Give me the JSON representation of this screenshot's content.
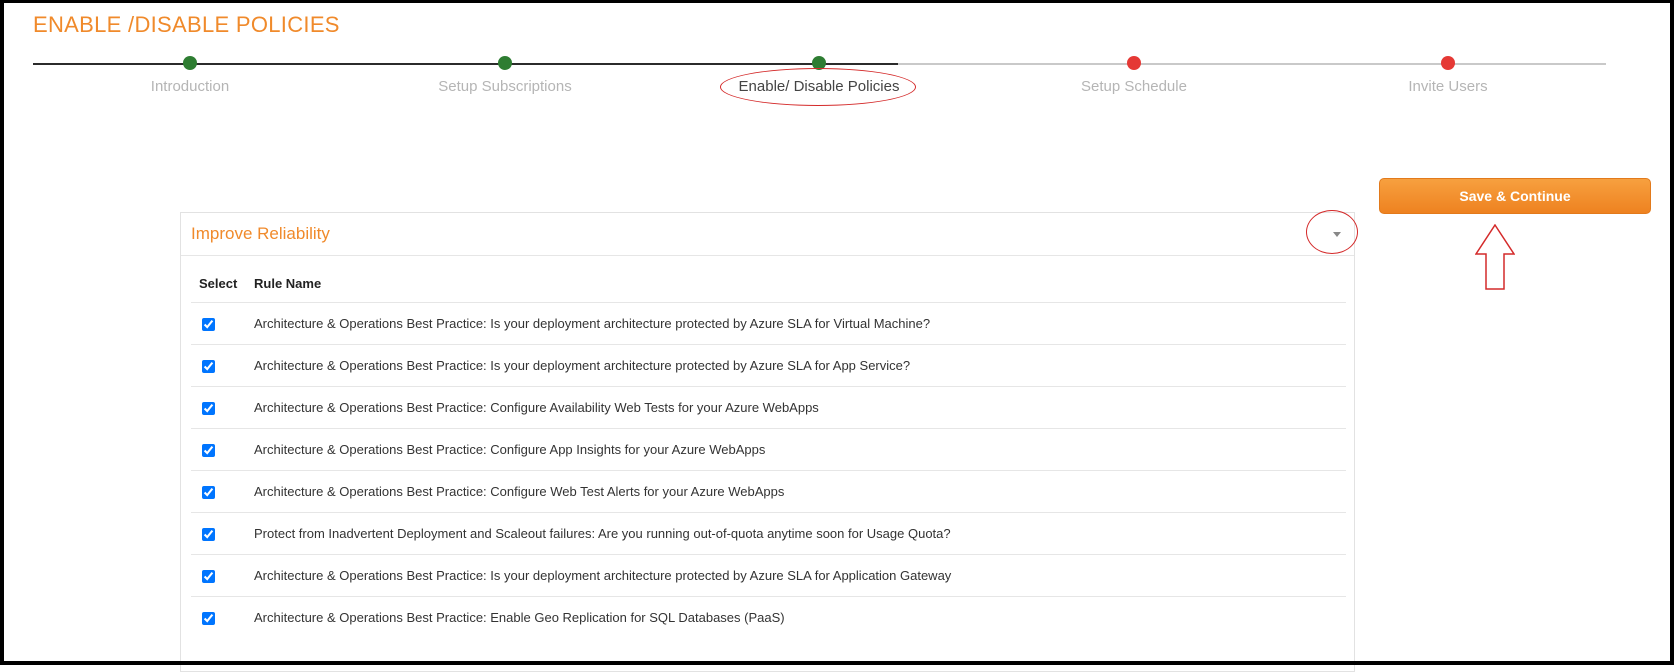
{
  "page": {
    "title": "ENABLE /DISABLE POLICIES"
  },
  "stepper": {
    "steps": [
      {
        "label": "Introduction",
        "status": "complete"
      },
      {
        "label": "Setup Subscriptions",
        "status": "complete"
      },
      {
        "label": "Enable/ Disable Policies",
        "status": "current"
      },
      {
        "label": "Setup Schedule",
        "status": "pending"
      },
      {
        "label": "Invite Users",
        "status": "pending"
      }
    ],
    "colors": {
      "complete": "#2e7d32",
      "pending": "#e53935"
    }
  },
  "actions": {
    "save_continue_label": "Save & Continue"
  },
  "panel": {
    "title": "Improve Reliability",
    "collapse_icon": "caret-down-icon",
    "columns": {
      "select": "Select",
      "rule_name": "Rule Name"
    },
    "rules": [
      {
        "name": "Architecture & Operations Best Practice: Is your deployment architecture protected by Azure SLA for Virtual Machine?",
        "selected": true
      },
      {
        "name": "Architecture & Operations Best Practice: Is your deployment architecture protected by Azure SLA for App Service?",
        "selected": true
      },
      {
        "name": "Architecture & Operations Best Practice: Configure Availability Web Tests for your Azure WebApps",
        "selected": true
      },
      {
        "name": "Architecture & Operations Best Practice: Configure App Insights for your Azure WebApps",
        "selected": true
      },
      {
        "name": "Architecture & Operations Best Practice: Configure Web Test Alerts for your Azure WebApps",
        "selected": true
      },
      {
        "name": "Protect from Inadvertent Deployment and Scaleout failures: Are you running out-of-quota anytime soon for Usage Quota?",
        "selected": true
      },
      {
        "name": "Architecture & Operations Best Practice: Is your deployment architecture protected by Azure SLA for Application Gateway",
        "selected": true
      },
      {
        "name": "Architecture & Operations Best Practice: Enable Geo Replication for SQL Databases (PaaS)",
        "selected": true
      }
    ]
  },
  "annotations": {
    "highlight_color": "#d42a2a"
  },
  "theme": {
    "accent": "#f08a2b"
  }
}
